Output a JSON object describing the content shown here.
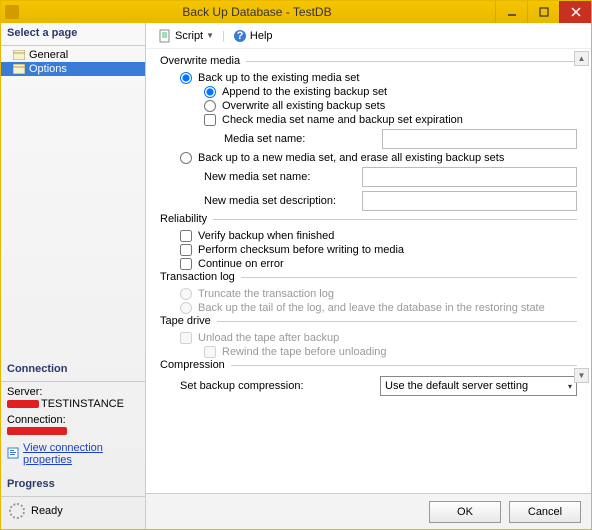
{
  "window": {
    "title": "Back Up Database - TestDB"
  },
  "left": {
    "select_page": "Select a page",
    "general": "General",
    "options": "Options",
    "connection_hdr": "Connection",
    "server_lbl": "Server:",
    "server_val": "TESTINSTANCE",
    "connection_lbl": "Connection:",
    "view_conn": "View connection properties",
    "progress_hdr": "Progress",
    "ready": "Ready"
  },
  "toolbar": {
    "script": "Script",
    "help": "Help"
  },
  "overwrite": {
    "legend": "Overwrite media",
    "existing": "Back up to the existing media set",
    "append": "Append to the existing backup set",
    "overwrite_all": "Overwrite all existing backup sets",
    "check_media": "Check media set name and backup set expiration",
    "media_set_name": "Media set name:",
    "new_media": "Back up to a new media set, and erase all existing backup sets",
    "new_media_name": "New media set name:",
    "new_media_desc": "New media set description:"
  },
  "reliability": {
    "legend": "Reliability",
    "verify": "Verify backup when finished",
    "checksum": "Perform checksum before writing to media",
    "continue": "Continue on error"
  },
  "tlog": {
    "legend": "Transaction log",
    "truncate": "Truncate the transaction log",
    "tail": "Back up the tail of the log, and leave the database in the restoring state"
  },
  "tape": {
    "legend": "Tape drive",
    "unload": "Unload the tape after backup",
    "rewind": "Rewind the tape before unloading"
  },
  "compression": {
    "legend": "Compression",
    "label": "Set backup compression:",
    "value": "Use the default server setting"
  },
  "buttons": {
    "ok": "OK",
    "cancel": "Cancel"
  }
}
